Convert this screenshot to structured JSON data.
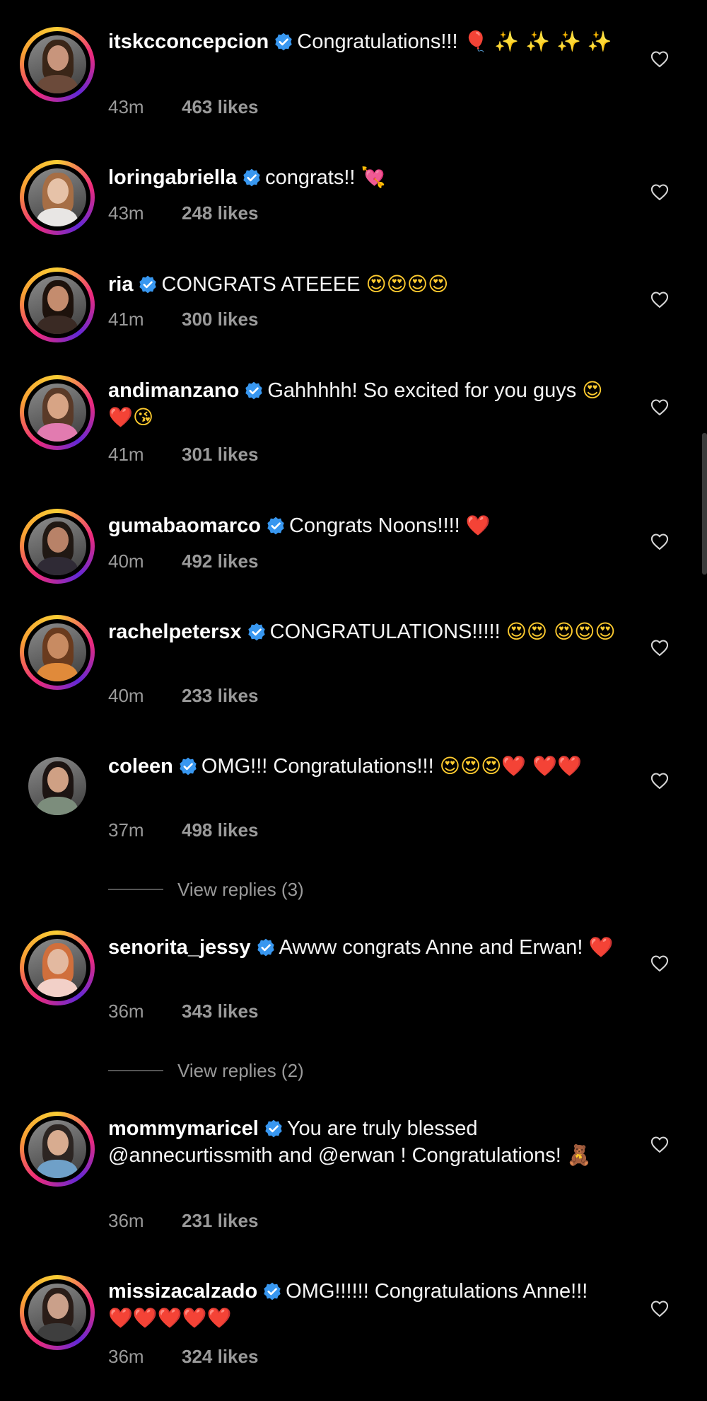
{
  "comments": [
    {
      "username": "itskcconcepcion",
      "text": "Congratulations!!!",
      "emoji": "🎈 ✨ ✨ ✨ ✨",
      "time": "43m",
      "likes": "463 likes",
      "skin": "#c8957c",
      "hair": "#3a2618",
      "shirt": "#6b4a3a",
      "ring": true
    },
    {
      "username": "loringabriella",
      "text": "congrats!!",
      "emoji": "💘",
      "time": "43m",
      "likes": "248 likes",
      "skin": "#e6c2a8",
      "hair": "#a66e45",
      "shirt": "#e8e6e4",
      "ring": true
    },
    {
      "username": "ria",
      "text": "CONGRATS ATEEEE",
      "emoji": "😍😍😍😍",
      "time": "41m",
      "likes": "300 likes",
      "skin": "#c48c6e",
      "hair": "#1d120c",
      "shirt": "#3a2a24",
      "ring": true
    },
    {
      "username": "andimanzano",
      "text": "Gahhhhh! So excited for you guys",
      "emoji": "😍❤️😘",
      "time": "41m",
      "likes": "301 likes",
      "skin": "#d7a485",
      "hair": "#5a3a28",
      "shirt": "#e27bb0",
      "ring": true
    },
    {
      "username": "gumabaomarco",
      "text": "Congrats Noons!!!!",
      "emoji": "❤️",
      "time": "40m",
      "likes": "492 likes",
      "skin": "#b88268",
      "hair": "#201813",
      "shirt": "#2f2a35",
      "ring": true
    },
    {
      "username": "rachelpetersx",
      "text": "CONGRATULATIONS!!!!!",
      "emoji": "😍😍 😍😍😍",
      "time": "40m",
      "likes": "233 likes",
      "skin": "#c88b62",
      "hair": "#6a3b1e",
      "shirt": "#e08a3a",
      "ring": true
    },
    {
      "username": "coleen",
      "text": "OMG!!! Congratulations!!!",
      "emoji": "😍😍😍❤️ ❤️❤️",
      "time": "37m",
      "likes": "498 likes",
      "skin": "#cfa084",
      "hair": "#1c1412",
      "shirt": "#7c8d7c",
      "ring": false,
      "replies": "View replies (3)"
    },
    {
      "username": "senorita_jessy",
      "text": "Awww congrats Anne and Erwan!",
      "emoji": "❤️",
      "time": "36m",
      "likes": "343 likes",
      "skin": "#e3b9a0",
      "hair": "#d06f3c",
      "shirt": "#f2d0c8",
      "ring": true,
      "replies": "View replies (2)"
    },
    {
      "username": "mommymaricel",
      "text": "You are truly blessed @annecurtissmith and @erwan ! Congratulations!",
      "emoji": "🧸",
      "time": "36m",
      "likes": "231 likes",
      "skin": "#d8ac90",
      "hair": "#2c2522",
      "shirt": "#6fa0c8",
      "ring": true
    },
    {
      "username": "missizacalzado",
      "text": "OMG!!!!!! Congratulations Anne!!!",
      "emoji": "❤️❤️❤️❤️❤️",
      "time": "36m",
      "likes": "324 likes",
      "skin": "#caa08a",
      "hair": "#2a1d18",
      "shirt": "#3e3e3e",
      "ring": true
    }
  ],
  "colors": {
    "accent": "#3897f0",
    "heart": "#e0182d",
    "meta": "#9a9a9a"
  }
}
